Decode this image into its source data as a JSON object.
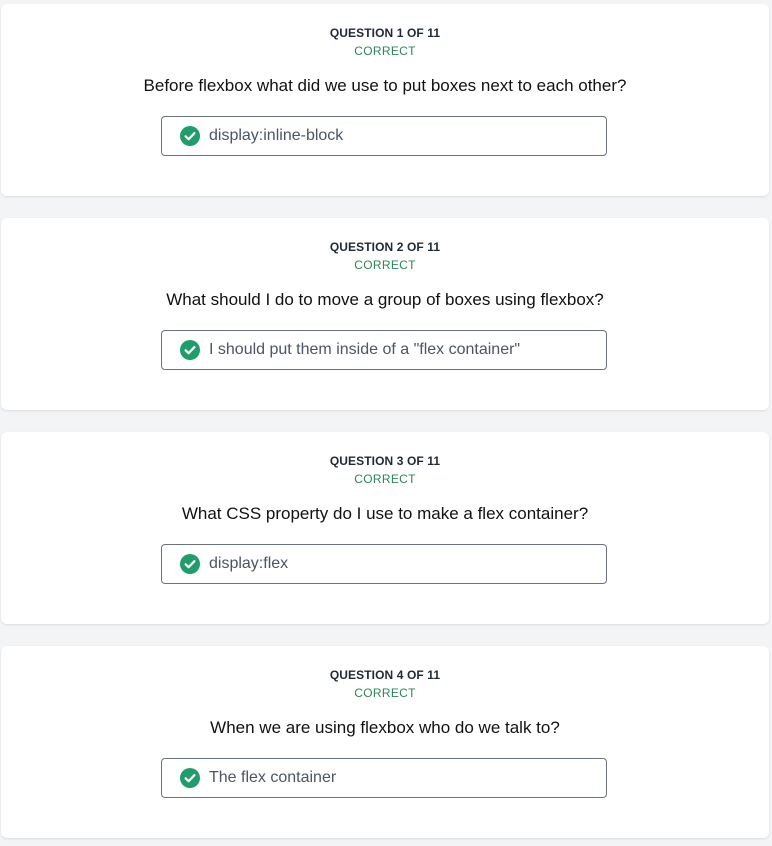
{
  "colors": {
    "page_background": "#f3f4f6",
    "card_background": "#ffffff",
    "status_correct": "#2f855a",
    "check_icon": "#1f9d6b",
    "answer_border": "#6b7280"
  },
  "questions": [
    {
      "label": "QUESTION 1 OF 11",
      "status": "CORRECT",
      "text": "Before flexbox what did we use to put boxes next to each other?",
      "answer": "display:inline-block",
      "answer_icon": "check-circle-icon"
    },
    {
      "label": "QUESTION 2 OF 11",
      "status": "CORRECT",
      "text": "What should I do to move a group of boxes using flexbox?",
      "answer": "I should put them inside of a \"flex container\"",
      "answer_icon": "check-circle-icon"
    },
    {
      "label": "QUESTION 3 OF 11",
      "status": "CORRECT",
      "text": "What CSS property do I use to make a flex container?",
      "answer": "display:flex",
      "answer_icon": "check-circle-icon"
    },
    {
      "label": "QUESTION 4 OF 11",
      "status": "CORRECT",
      "text": "When we are using flexbox who do we talk to?",
      "answer": "The flex container",
      "answer_icon": "check-circle-icon"
    }
  ]
}
